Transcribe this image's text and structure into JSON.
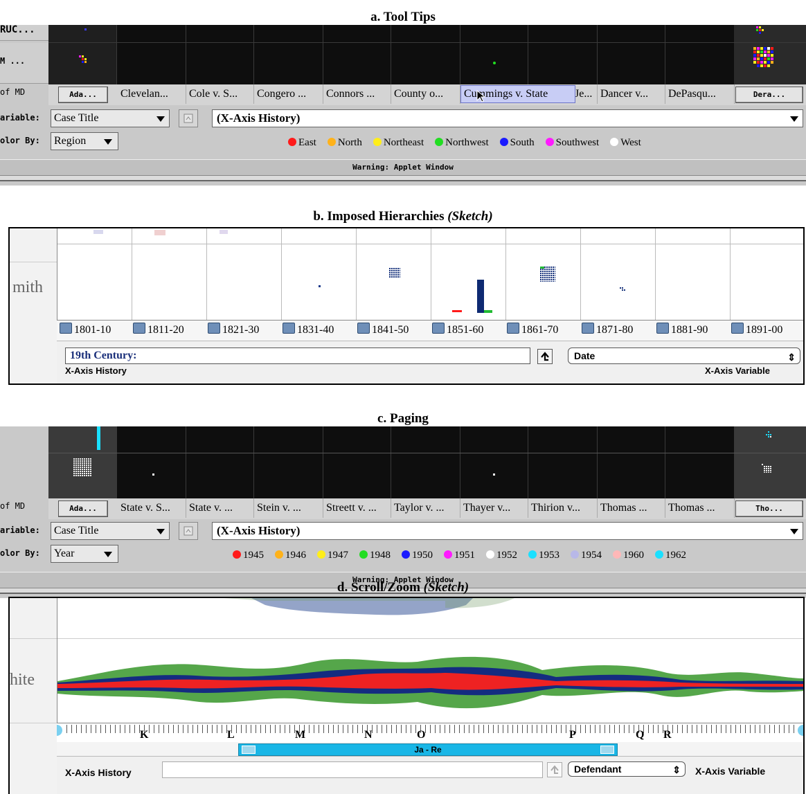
{
  "panel_a": {
    "title": "a. Tool Tips",
    "side_labels": [
      "RUC...",
      "M ...",
      "of MD"
    ],
    "columns": [
      "Ada...",
      "Clevelan...",
      "Cole v. S...",
      "Congero ...",
      "Connors ...",
      "County o...",
      "Cummings v. State",
      "Je...",
      "Dancer v...",
      "DePasqu...",
      "Dera..."
    ],
    "tooltip": "Cummings v. State",
    "variable_label": "ariable:",
    "variable_value": "Case Title",
    "history_value": "(X-Axis History)",
    "color_by_label": "olor By:",
    "color_by_value": "Region",
    "legend": [
      {
        "label": "East",
        "color": "#ff1a1a"
      },
      {
        "label": "North",
        "color": "#ffb21a"
      },
      {
        "label": "Northeast",
        "color": "#ffee1a"
      },
      {
        "label": "Northwest",
        "color": "#22dd22"
      },
      {
        "label": "South",
        "color": "#1a1aff"
      },
      {
        "label": "Southwest",
        "color": "#ff1aff"
      },
      {
        "label": "West",
        "color": "#ffffff"
      }
    ],
    "warning": "Warning: Applet Window"
  },
  "panel_b": {
    "title": "b. Imposed Hierarchies",
    "title_suffix": "(Sketch)",
    "row_label": "mith",
    "years": [
      "1801-10",
      "1811-20",
      "1821-30",
      "1831-40",
      "1841-50",
      "1851-60",
      "1861-70",
      "1871-80",
      "1881-90",
      "1891-00"
    ],
    "history_value": "19th Century:",
    "history_label": "X-Axis History",
    "variable_value": "Date",
    "variable_label": "X-Axis Variable"
  },
  "panel_c": {
    "title": "c. Paging",
    "side_labels": [
      "",
      "",
      "of MD"
    ],
    "columns": [
      "Ada...",
      "State v. S...",
      "State v. ...",
      "Stein v. ...",
      "Streett v. ...",
      "Taylor v. ...",
      "Thayer v...",
      "Thirion v...",
      "Thomas ...",
      "Thomas ...",
      "Tho..."
    ],
    "variable_label": "ariable:",
    "variable_value": "Case Title",
    "history_value": "(X-Axis History)",
    "color_by_label": "olor By:",
    "color_by_value": "Year",
    "legend": [
      {
        "label": "1945",
        "color": "#ff1a1a"
      },
      {
        "label": "1946",
        "color": "#ffb21a"
      },
      {
        "label": "1947",
        "color": "#ffee1a"
      },
      {
        "label": "1948",
        "color": "#22dd22"
      },
      {
        "label": "1950",
        "color": "#1a1aff"
      },
      {
        "label": "1951",
        "color": "#ff1aff"
      },
      {
        "label": "1952",
        "color": "#ffffff"
      },
      {
        "label": "1953",
        "color": "#1ae0ff"
      },
      {
        "label": "1954",
        "color": "#b8b8e8"
      },
      {
        "label": "1960",
        "color": "#ffb8b8"
      },
      {
        "label": "1962",
        "color": "#1ae0ff"
      }
    ],
    "warning": "Warning: Applet Window"
  },
  "panel_d": {
    "title": "d. Scroll/Zoom",
    "title_suffix": "(Sketch)",
    "row_label": "hite",
    "letters": [
      "K",
      "L",
      "M",
      "N",
      "O",
      "P",
      "Q",
      "R"
    ],
    "range_label": "Ja - Re",
    "history_label": "X-Axis History",
    "variable_value": "Defendant",
    "variable_label": "X-Axis Variable"
  },
  "colors": {
    "applet_gray": "#c9c9c9",
    "grid_black": "#0e0e0e",
    "tooltip_bg": "#c8cdf5",
    "scrollbar_blue": "#19b6e6",
    "band_green": "#55a64a",
    "band_blue": "#142c80",
    "band_red": "#ee2222"
  }
}
